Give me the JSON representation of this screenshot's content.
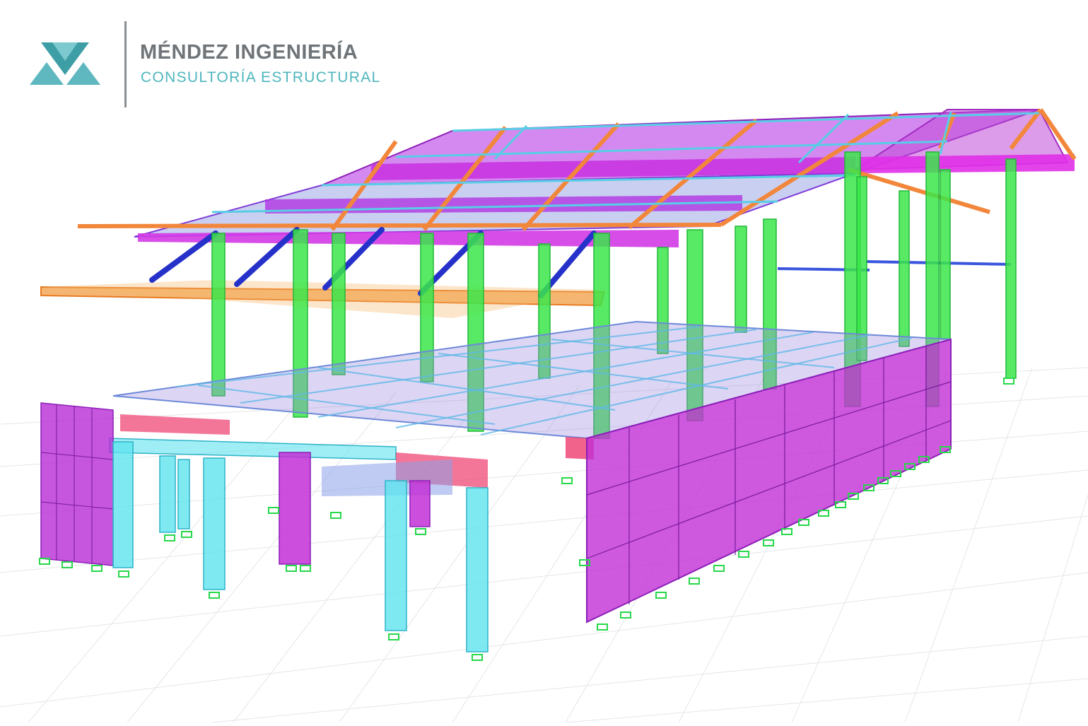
{
  "brand": {
    "name": "MÉNDEZ INGENIERÍA",
    "tagline": "CONSULTORÍA ESTRUCTURAL",
    "logo_icon": "triangles-m-logo",
    "colors": {
      "name": "#6f7478",
      "tagline": "#4fb6bd",
      "logo_teal": "#5fb8bf",
      "logo_dark": "#3e9ea6"
    }
  },
  "model": {
    "view": "3d-structural-model",
    "colors": {
      "columns_green": "#3be64a",
      "columns_cyan": "#5fe3ef",
      "walls_magenta": "#c230d6",
      "beams_red": "#ee3c6e",
      "roof_purple": "#b73ae6",
      "rafters_orange": "#f2873b",
      "braces_blue": "#2531c9",
      "slab_lavender": "#9c88e0",
      "supports": "#27d84a",
      "grid": "#e3e6ea"
    }
  }
}
